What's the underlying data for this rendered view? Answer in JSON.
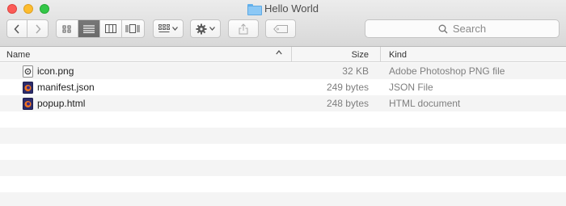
{
  "window": {
    "title": "Hello World"
  },
  "toolbar": {
    "search_placeholder": "Search"
  },
  "columns": {
    "name": "Name",
    "size": "Size",
    "kind": "Kind"
  },
  "files": [
    {
      "name": "icon.png",
      "size": "32 KB",
      "kind": "Adobe Photoshop PNG file",
      "icon": "image-file-icon"
    },
    {
      "name": "manifest.json",
      "size": "249 bytes",
      "kind": "JSON File",
      "icon": "firefox-document-icon"
    },
    {
      "name": "popup.html",
      "size": "248 bytes",
      "kind": "HTML document",
      "icon": "firefox-document-icon"
    }
  ],
  "colors": {
    "close": "#fc5b57",
    "minimize": "#fdbc2e",
    "maximize": "#33c748",
    "folder": "#8cc8f5",
    "active_view": "#6b6b6b",
    "alt_row": "#f4f4f4"
  }
}
